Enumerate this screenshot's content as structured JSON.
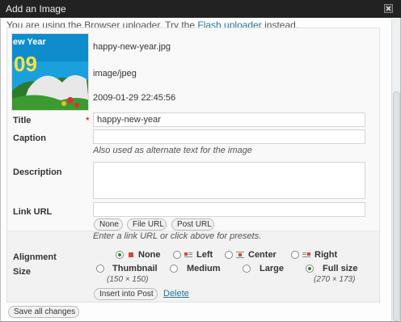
{
  "window": {
    "title": "Add an Image"
  },
  "uploader_note": {
    "prefix": "You are using the Browser uploader. Try the ",
    "link": "Flash uploader",
    "suffix": " instead."
  },
  "file": {
    "name": "happy-new-year.jpg",
    "type": "image/jpeg",
    "date": "2009-01-29 22:45:56",
    "thumb_text": "ew Year",
    "thumb_year": "09"
  },
  "fields": {
    "title": {
      "label": "Title",
      "required_mark": "*",
      "value": "happy-new-year"
    },
    "caption": {
      "label": "Caption",
      "value": "",
      "help": "Also used as alternate text for the image"
    },
    "description": {
      "label": "Description",
      "value": ""
    },
    "link_url": {
      "label": "Link URL",
      "value": "",
      "help": "Enter a link URL or click above for presets."
    }
  },
  "link_buttons": [
    "None",
    "File URL",
    "Post URL"
  ],
  "alignment": {
    "label": "Alignment",
    "selected": "None",
    "options": [
      "None",
      "Left",
      "Center",
      "Right"
    ]
  },
  "size": {
    "label": "Size",
    "selected": "Full size",
    "options": [
      {
        "label": "Thumbnail",
        "dims": "(150 × 150)"
      },
      {
        "label": "Medium",
        "dims": ""
      },
      {
        "label": "Large",
        "dims": ""
      },
      {
        "label": "Full size",
        "dims": "(270 × 173)"
      }
    ]
  },
  "actions": {
    "insert": "Insert into Post",
    "delete": "Delete",
    "save_all": "Save all changes"
  },
  "colors": {
    "titlebar": "#222222",
    "link": "#21759b",
    "required": "#cc0000",
    "radio_checked": "#2a8a2a"
  },
  "icons": [
    "close-icon",
    "align-none-icon",
    "align-left-icon",
    "align-center-icon",
    "align-right-icon"
  ]
}
